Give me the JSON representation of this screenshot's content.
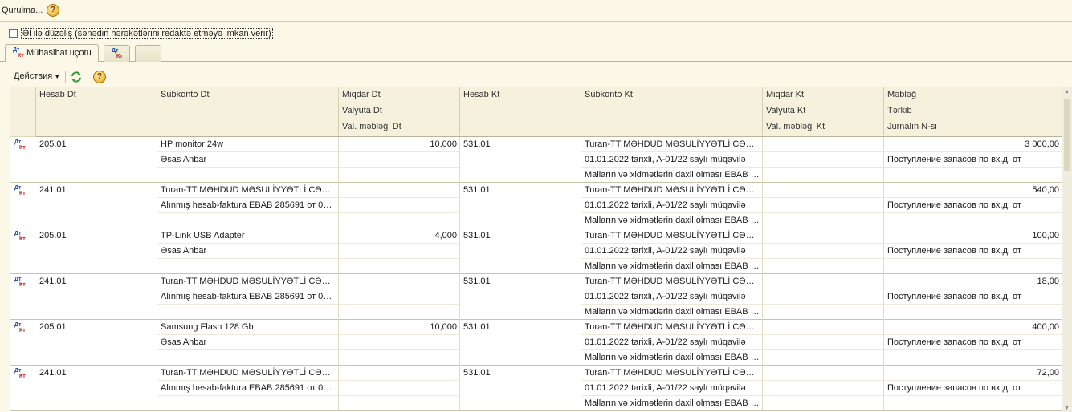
{
  "topbar": {
    "menu_label": "Qurulma...",
    "help_icon": "help-icon"
  },
  "manual_edit": {
    "checked": false,
    "label": "Əl ilə düzəliş (sənədin hərəkətlərini redaktə etməyə imkan verir)"
  },
  "tabs": [
    {
      "label": "Mühasibat uçotu",
      "icon": "dt-kt-icon",
      "active": true
    },
    {
      "label": "",
      "icon": "dt-kt-icon",
      "active": false
    },
    {
      "label": "",
      "icon": "",
      "active": false
    }
  ],
  "toolbar": {
    "actions_label": "Действия",
    "refresh_icon": "refresh-icon",
    "help_icon": "help-icon"
  },
  "grid": {
    "headers": {
      "hesab_dt": "Hesab Dt",
      "subkonto_dt": "Subkonto Dt",
      "miqdar_dt": "Miqdar Dt",
      "valyuta_dt": "Valyuta Dt",
      "val_mebleg_dt": "Val. məbləği Dt",
      "hesab_kt": "Hesab Kt",
      "subkonto_kt": "Subkonto Kt",
      "miqdar_kt": "Miqdar Kt",
      "valyuta_kt": "Valyuta Kt",
      "val_mebleg_kt": "Val. məbləği Kt",
      "mebleg": "Məbləğ",
      "terkib": "Tərkib",
      "jurnal": "Jurnalın N-si"
    },
    "rows": [
      {
        "hesab_dt": "205.01",
        "subkonto_dt": [
          "HP monitor 24w",
          "Əsas Anbar",
          ""
        ],
        "miqdar_dt": "10,000",
        "hesab_kt": "531.01",
        "subkonto_kt": [
          "Turan-TT MƏHDUD MƏSULİYYƏTLİ CƏM...",
          "01.01.2022 tarixli, A-01/22 saylı müqavilə",
          "Malların və xidmətlərin daxil olması EBAB 28..."
        ],
        "mebleg": "3 000,00",
        "terkib": "Поступление запасов по вх.д. от"
      },
      {
        "hesab_dt": "241.01",
        "subkonto_dt": [
          "Turan-TT MƏHDUD MƏSULİYYƏTLİ CƏM...",
          "Alınmış hesab-faktura EBAB 285691 от 01.0...",
          ""
        ],
        "miqdar_dt": "",
        "hesab_kt": "531.01",
        "subkonto_kt": [
          "Turan-TT MƏHDUD MƏSULİYYƏTLİ CƏM...",
          "01.01.2022 tarixli, A-01/22 saylı müqavilə",
          "Malların və xidmətlərin daxil olması EBAB 28..."
        ],
        "mebleg": "540,00",
        "terkib": "Поступление запасов по вх.д. от"
      },
      {
        "hesab_dt": "205.01",
        "subkonto_dt": [
          "TP-Link USB Adapter",
          "Əsas Anbar",
          ""
        ],
        "miqdar_dt": "4,000",
        "hesab_kt": "531.01",
        "subkonto_kt": [
          "Turan-TT MƏHDUD MƏSULİYYƏTLİ CƏM...",
          "01.01.2022 tarixli, A-01/22 saylı müqavilə",
          "Malların və xidmətlərin daxil olması EBAB 28..."
        ],
        "mebleg": "100,00",
        "terkib": "Поступление запасов по вх.д. от"
      },
      {
        "hesab_dt": "241.01",
        "subkonto_dt": [
          "Turan-TT MƏHDUD MƏSULİYYƏTLİ CƏM...",
          "Alınmış hesab-faktura EBAB 285691 от 01.0...",
          ""
        ],
        "miqdar_dt": "",
        "hesab_kt": "531.01",
        "subkonto_kt": [
          "Turan-TT MƏHDUD MƏSULİYYƏTLİ CƏM...",
          "01.01.2022 tarixli, A-01/22 saylı müqavilə",
          "Malların və xidmətlərin daxil olması EBAB 28..."
        ],
        "mebleg": "18,00",
        "terkib": "Поступление запасов по вх.д. от"
      },
      {
        "hesab_dt": "205.01",
        "subkonto_dt": [
          "Samsung Flash 128 Gb",
          "Əsas Anbar",
          ""
        ],
        "miqdar_dt": "10,000",
        "hesab_kt": "531.01",
        "subkonto_kt": [
          "Turan-TT MƏHDUD MƏSULİYYƏTLİ CƏM...",
          "01.01.2022 tarixli, A-01/22 saylı müqavilə",
          "Malların və xidmətlərin daxil olması EBAB 28..."
        ],
        "mebleg": "400,00",
        "terkib": "Поступление запасов по вх.д. от"
      },
      {
        "hesab_dt": "241.01",
        "subkonto_dt": [
          "Turan-TT MƏHDUD MƏSULİYYƏTLİ CƏM...",
          "Alınmış hesab-faktura EBAB 285691 от 01.0...",
          ""
        ],
        "miqdar_dt": "",
        "hesab_kt": "531.01",
        "subkonto_kt": [
          "Turan-TT MƏHDUD MƏSULİYYƏTLİ CƏM...",
          "01.01.2022 tarixli, A-01/22 saylı müqavilə",
          "Malların və xidmətlərin daxil olması EBAB 28..."
        ],
        "mebleg": "72,00",
        "terkib": "Поступление запасов по вх.д. от"
      }
    ]
  },
  "icon_labels": {
    "dt": "Дт",
    "kt": "Кт"
  },
  "colors": {
    "background": "#fbf8e8",
    "header": "#f5f1dc",
    "dt": "#1b4aa8",
    "kt": "#c01818"
  }
}
